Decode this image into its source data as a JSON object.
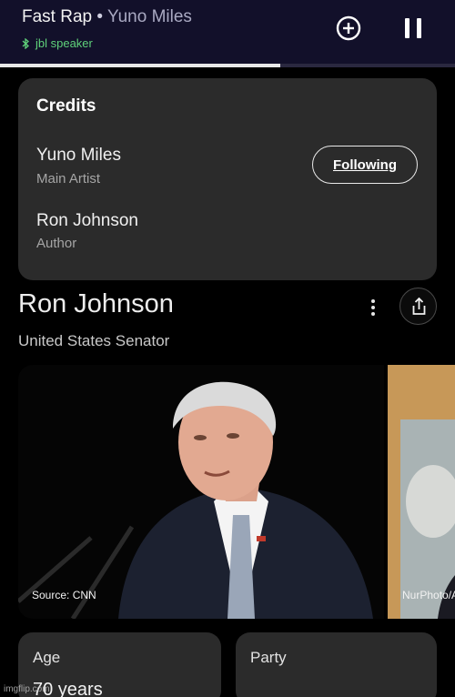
{
  "player": {
    "song": "Fast Rap",
    "separator": "•",
    "artist": "Yuno Miles",
    "device": "jbl speaker",
    "progress": 0.615,
    "add_icon": "add-circle-icon",
    "pause_icon": "pause-icon",
    "device_icon": "bluetooth-icon"
  },
  "credits": {
    "title": "Credits",
    "entries": [
      {
        "name": "Yuno Miles",
        "role": "Main Artist"
      },
      {
        "name": "Ron Johnson",
        "role": "Author"
      }
    ],
    "follow_label": "Following"
  },
  "knowledge_panel": {
    "name": "Ron Johnson",
    "subtitle": "United States Senator",
    "more_icon": "more-vert-icon",
    "share_icon": "share-icon",
    "photos": [
      {
        "source": "Source: CNN"
      },
      {
        "source": "NurPhoto/A"
      }
    ],
    "facts": [
      {
        "label": "Age",
        "value": "70 years"
      },
      {
        "label": "Party",
        "value": ""
      }
    ]
  },
  "watermark": "imgflip.com",
  "colors": {
    "player_bg": "#12102a",
    "device_green": "#5fd17a",
    "card_bg": "#2b2b2b"
  }
}
